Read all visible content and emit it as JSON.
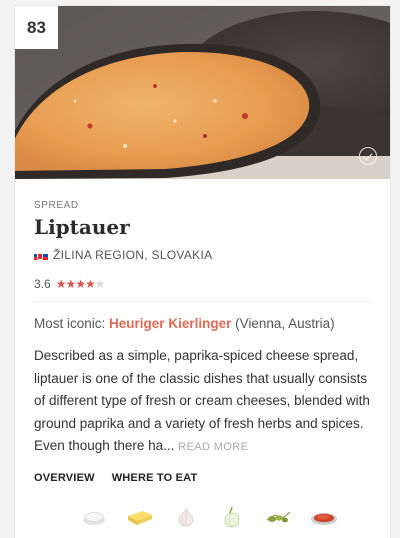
{
  "rank": "83",
  "category": "Spread",
  "dish_name": "Liptauer",
  "region": "ŽILINA REGION, SLOVAKIA",
  "rating": {
    "value": "3.6",
    "stars_filled": 4,
    "stars_total": 5
  },
  "most_iconic": {
    "prefix": "Most iconic:",
    "place": "Heuriger Kierlinger",
    "location": "(Vienna, Austria)"
  },
  "description": "Described as a simple, paprika-spiced cheese spread, liptauer is one of the classic dishes that usually consists of different type of fresh or cream cheeses, blended with ground paprika and a variety of fresh herbs and spices. Even though there ha...",
  "read_more_label": "READ MORE",
  "tabs": [
    "OVERVIEW",
    "WHERE TO EAT"
  ],
  "ingredient_icons": [
    "cream-cheese-icon",
    "butter-icon",
    "garlic-icon",
    "onion-icon",
    "capers-icon",
    "paprika-icon"
  ],
  "colors": {
    "accent": "#e06a52",
    "star": "#d9534f"
  }
}
